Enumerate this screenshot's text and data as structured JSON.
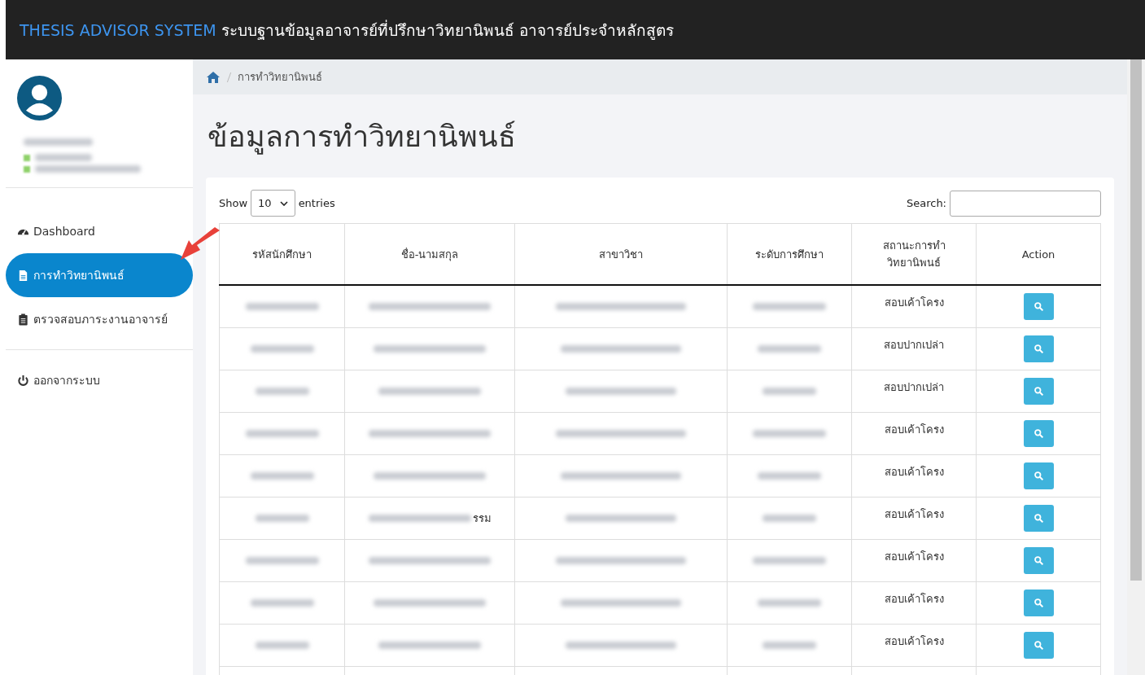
{
  "header": {
    "brand": "THESIS ADVISOR SYSTEM",
    "title": "ระบบฐานข้อมูลอาจารย์ที่ปรึกษาวิทยานิพนธ์ อาจารย์ประจำหลักสูตร"
  },
  "sidebar": {
    "items": [
      {
        "label": "Dashboard",
        "selected": false
      },
      {
        "label": "การทำวิทยานิพนธ์",
        "selected": true
      },
      {
        "label": "ตรวจสอบภาระงานอาจารย์",
        "selected": false
      },
      {
        "label": "ออกจากระบบ",
        "selected": false
      }
    ]
  },
  "breadcrumb": {
    "current": "การทำวิทยานิพนธ์"
  },
  "page_title": "ข้อมูลการทำวิทยานิพนธ์",
  "table_controls": {
    "show_label": "Show",
    "page_size": "10",
    "entries_label": "entries",
    "search_label": "Search:"
  },
  "table": {
    "columns": [
      "รหัสนักศึกษา",
      "ชื่อ-นามสกุล",
      "สาขาวิชา",
      "ระดับการศึกษา",
      "สถานะการทำวิทยานิพนธ์",
      "Action"
    ],
    "rows": [
      {
        "status": "สอบเค้าโครง"
      },
      {
        "status": "สอบปากเปล่า"
      },
      {
        "status": "สอบปากเปล่า"
      },
      {
        "status": "สอบเค้าโครง"
      },
      {
        "status": "สอบเค้าโครง"
      },
      {
        "status": "สอบเค้าโครง",
        "name_visible_part": "รรม"
      },
      {
        "status": "สอบเค้าโครง"
      },
      {
        "status": "สอบเค้าโครง"
      },
      {
        "status": "สอบเค้าโครง"
      }
    ]
  }
}
